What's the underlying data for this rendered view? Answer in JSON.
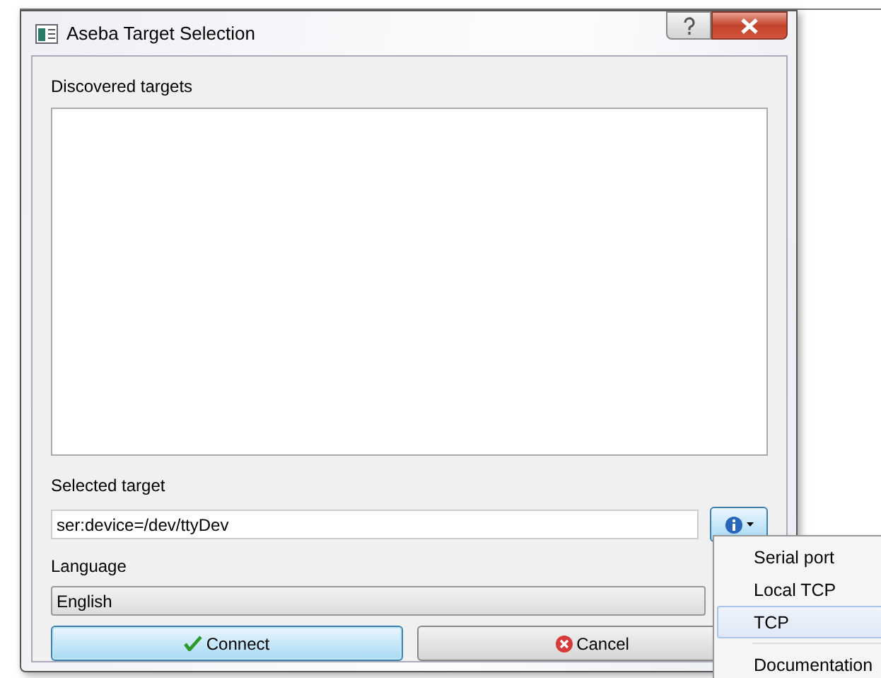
{
  "window": {
    "title": "Aseba Target Selection"
  },
  "targets": {
    "label": "Discovered targets"
  },
  "selected_target": {
    "label": "Selected target",
    "value": "ser:device=/dev/ttyDev"
  },
  "language": {
    "label": "Language",
    "value": "English"
  },
  "buttons": [
    {
      "label": "Connect",
      "kind": "connect"
    },
    {
      "label": "Cancel",
      "kind": "cancel"
    }
  ],
  "menu": [
    {
      "label": "Serial port",
      "selected": false
    },
    {
      "label": "Local TCP",
      "selected": false
    },
    {
      "label": "TCP",
      "selected": true
    },
    {
      "label": "Documentation",
      "selected": false,
      "separator_before": true
    }
  ]
}
